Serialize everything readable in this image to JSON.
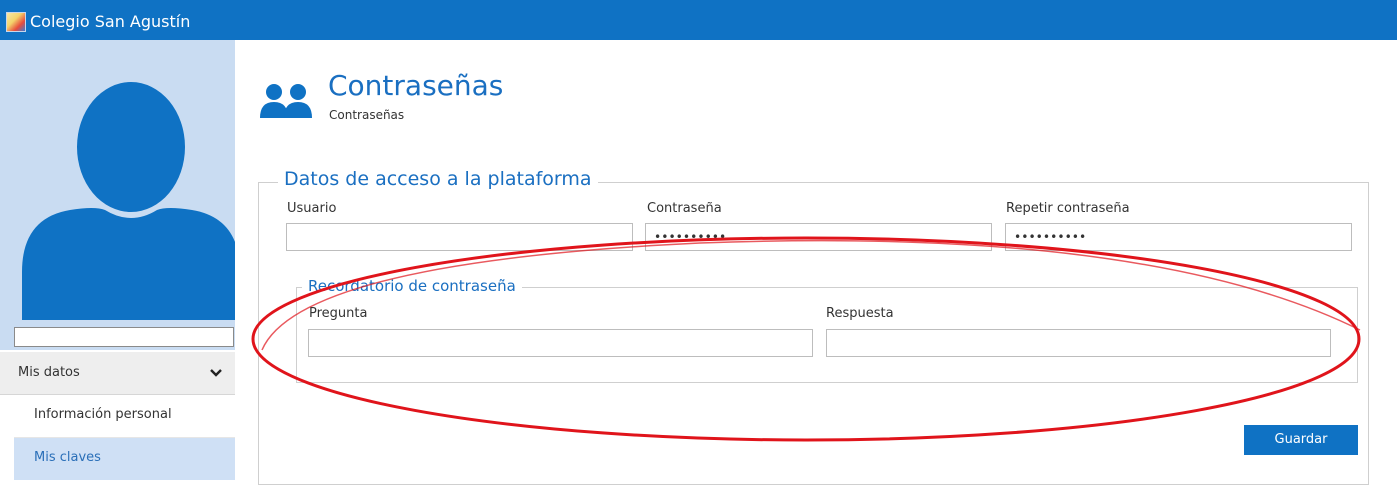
{
  "app": {
    "title": "Colegio San Agustín"
  },
  "sidebar": {
    "menu_header": "Mis datos",
    "items": [
      {
        "label": "Información personal",
        "selected": false
      },
      {
        "label": "Mis claves",
        "selected": true
      }
    ]
  },
  "page": {
    "title": "Contraseñas",
    "subtitle": "Contraseñas"
  },
  "access": {
    "legend": "Datos de acceso a la plataforma",
    "user_label": "Usuario",
    "user_value": "",
    "password_label": "Contraseña",
    "password_value": "••••••••••",
    "repeat_label": "Repetir contraseña",
    "repeat_value": "••••••••••"
  },
  "reminder": {
    "legend": "Recordatorio de contraseña",
    "question_label": "Pregunta",
    "question_value": "",
    "answer_label": "Respuesta",
    "answer_value": ""
  },
  "actions": {
    "save_label": "Guardar"
  },
  "colors": {
    "primary": "#0f72c4",
    "accent_text": "#1a6fc1",
    "sidebar_selected_bg": "#cfe0f5",
    "annotation": "#e0141b"
  },
  "icons": {
    "logo": "school-logo-icon",
    "page": "users-icon",
    "menu_toggle": "chevron-down-icon",
    "avatar": "user-silhouette-icon"
  }
}
